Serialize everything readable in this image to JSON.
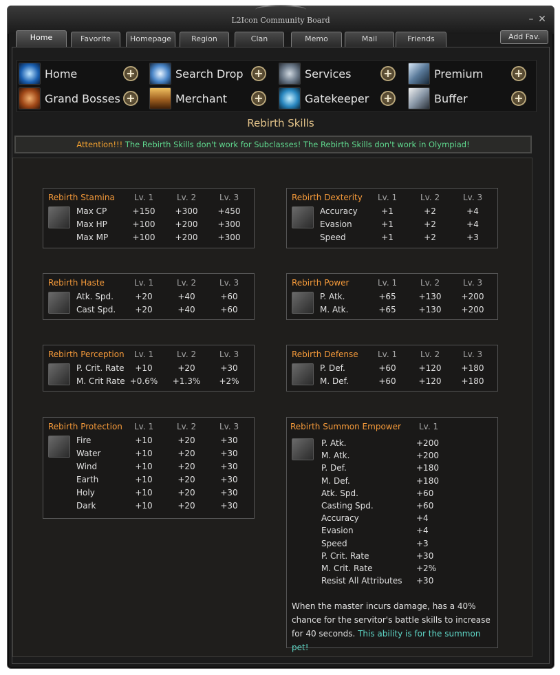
{
  "window": {
    "title": "L2Icon Community Board"
  },
  "tabs": [
    "Home",
    "Favorite",
    "Homepage",
    "Region",
    "Clan",
    "Memo",
    "Mail",
    "Friends"
  ],
  "add_fav": "Add Fav.",
  "nav": [
    {
      "label": "Home",
      "icon": "home-icon"
    },
    {
      "label": "Search Drop",
      "icon": "search-drop-icon"
    },
    {
      "label": "Services",
      "icon": "gear-icon"
    },
    {
      "label": "Premium",
      "icon": "premium-icon"
    },
    {
      "label": "Grand Bosses",
      "icon": "dragon-icon"
    },
    {
      "label": "Merchant",
      "icon": "chest-icon"
    },
    {
      "label": "Gatekeeper",
      "icon": "portal-icon"
    },
    {
      "label": "Buffer",
      "icon": "knight-icon"
    }
  ],
  "page_title": "Rebirth Skills",
  "attention": {
    "prefix": "Attention!!!",
    "text": "The Rebirth Skills don't work for Subclasses! The Rebirth Skills don't work in Olympiad!"
  },
  "levels": [
    "Lv. 1",
    "Lv. 2",
    "Lv. 3"
  ],
  "skills": [
    {
      "name": "Rebirth Stamina",
      "icon": "stamina-icon",
      "rows": [
        [
          "Max CP",
          "+150",
          "+300",
          "+450"
        ],
        [
          "Max HP",
          "+100",
          "+200",
          "+300"
        ],
        [
          "Max MP",
          "+100",
          "+200",
          "+300"
        ]
      ]
    },
    {
      "name": "Rebirth Dexterity",
      "icon": "eye-icon",
      "rows": [
        [
          "Accuracy",
          "+1",
          "+2",
          "+4"
        ],
        [
          "Evasion",
          "+1",
          "+2",
          "+4"
        ],
        [
          "Speed",
          "+1",
          "+2",
          "+3"
        ]
      ]
    },
    {
      "name": "Rebirth Haste",
      "icon": "haste-icon",
      "rows": [
        [
          "Atk. Spd.",
          "+20",
          "+40",
          "+60"
        ],
        [
          "Cast Spd.",
          "+20",
          "+40",
          "+60"
        ]
      ]
    },
    {
      "name": "Rebirth Power",
      "icon": "power-icon",
      "rows": [
        [
          "P. Atk.",
          "+65",
          "+130",
          "+200"
        ],
        [
          "M. Atk.",
          "+65",
          "+130",
          "+200"
        ]
      ]
    },
    {
      "name": "Rebirth Perception",
      "icon": "arrows-icon",
      "rows": [
        [
          "P. Crit. Rate",
          "+10",
          "+20",
          "+30"
        ],
        [
          "M. Crit Rate",
          "+0.6%",
          "+1.3%",
          "+2%"
        ]
      ]
    },
    {
      "name": "Rebirth Defense",
      "icon": "shield-icon",
      "rows": [
        [
          "P. Def.",
          "+60",
          "+120",
          "+180"
        ],
        [
          "M. Def.",
          "+60",
          "+120",
          "+180"
        ]
      ]
    },
    {
      "name": "Rebirth Protection",
      "icon": "wheel-icon",
      "rows": [
        [
          "Fire",
          "+10",
          "+20",
          "+30"
        ],
        [
          "Water",
          "+10",
          "+20",
          "+30"
        ],
        [
          "Wind",
          "+10",
          "+20",
          "+30"
        ],
        [
          "Earth",
          "+10",
          "+20",
          "+30"
        ],
        [
          "Holy",
          "+10",
          "+20",
          "+30"
        ],
        [
          "Dark",
          "+10",
          "+20",
          "+30"
        ]
      ]
    }
  ],
  "summon": {
    "name": "Rebirth Summon Empower",
    "icon": "paw-icon",
    "level": "Lv. 1",
    "rows": [
      [
        "P. Atk.",
        "+200"
      ],
      [
        "M. Atk.",
        "+200"
      ],
      [
        "P. Def.",
        "+180"
      ],
      [
        "M. Def.",
        "+180"
      ],
      [
        "Atk. Spd.",
        "+60"
      ],
      [
        "Casting Spd.",
        "+60"
      ],
      [
        "Accuracy",
        "+4"
      ],
      [
        "Evasion",
        "+4"
      ],
      [
        "Speed",
        "+3"
      ],
      [
        "P. Crit. Rate",
        "+30"
      ],
      [
        "M. Crit. Rate",
        "+2%"
      ],
      [
        "Resist All Attributes",
        "+30"
      ]
    ],
    "desc": "When the master incurs damage, has a 40% chance for the servitor's battle skills to increase for 40 seconds.",
    "note": "This ability is for the summon pet!"
  }
}
